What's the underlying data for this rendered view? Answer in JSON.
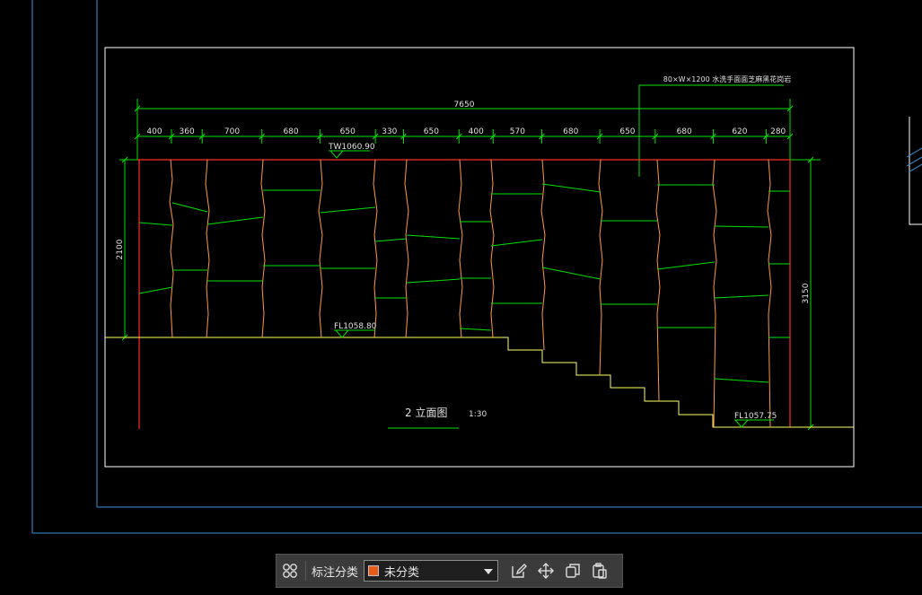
{
  "drawing": {
    "total_dimension": "7650",
    "dimension_segments": [
      "400",
      "360",
      "700",
      "680",
      "650",
      "330",
      "650",
      "400",
      "570",
      "680",
      "650",
      "680",
      "620",
      "280"
    ],
    "note_text": "80×W×1200 水洗手面面芝麻黑花岗岩",
    "tw_level": "TW1060.90",
    "fl_level_upper": "FL1058.80",
    "fl_level_lower": "FL1057.75",
    "left_height": "2100",
    "right_height": "3150",
    "view_title": "2 立面图",
    "view_scale": "1:30",
    "colors": {
      "dimension": "#00e000",
      "outline": "#ff2a2a",
      "stone_edge": "#ff9a3c",
      "frame": "#ffffff",
      "viewport": "#3b8fd8",
      "ground": "#ffff66"
    }
  },
  "toolbar": {
    "label": "标注分类",
    "selected_category": "未分类",
    "category_color": "#e85a1a",
    "icons": [
      "grid-icon",
      "edit-icon",
      "move-icon",
      "copy-icon",
      "paste-icon"
    ]
  }
}
